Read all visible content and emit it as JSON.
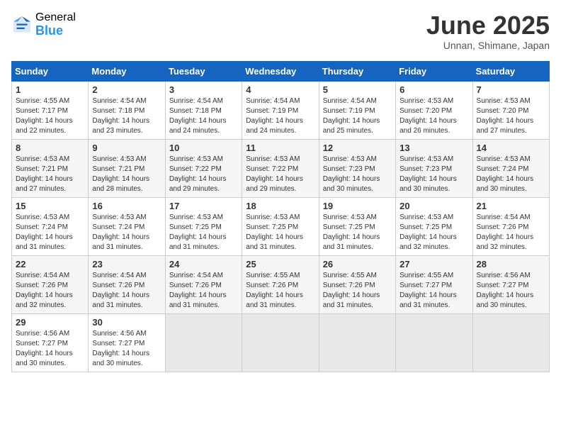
{
  "header": {
    "logo_general": "General",
    "logo_blue": "Blue",
    "title": "June 2025",
    "subtitle": "Unnan, Shimane, Japan"
  },
  "calendar": {
    "days_of_week": [
      "Sunday",
      "Monday",
      "Tuesday",
      "Wednesday",
      "Thursday",
      "Friday",
      "Saturday"
    ],
    "weeks": [
      [
        {
          "day": "1",
          "sunrise": "4:55 AM",
          "sunset": "7:17 PM",
          "daylight": "14 hours and 22 minutes."
        },
        {
          "day": "2",
          "sunrise": "4:54 AM",
          "sunset": "7:18 PM",
          "daylight": "14 hours and 23 minutes."
        },
        {
          "day": "3",
          "sunrise": "4:54 AM",
          "sunset": "7:18 PM",
          "daylight": "14 hours and 24 minutes."
        },
        {
          "day": "4",
          "sunrise": "4:54 AM",
          "sunset": "7:19 PM",
          "daylight": "14 hours and 24 minutes."
        },
        {
          "day": "5",
          "sunrise": "4:54 AM",
          "sunset": "7:19 PM",
          "daylight": "14 hours and 25 minutes."
        },
        {
          "day": "6",
          "sunrise": "4:53 AM",
          "sunset": "7:20 PM",
          "daylight": "14 hours and 26 minutes."
        },
        {
          "day": "7",
          "sunrise": "4:53 AM",
          "sunset": "7:20 PM",
          "daylight": "14 hours and 27 minutes."
        }
      ],
      [
        {
          "day": "8",
          "sunrise": "4:53 AM",
          "sunset": "7:21 PM",
          "daylight": "14 hours and 27 minutes."
        },
        {
          "day": "9",
          "sunrise": "4:53 AM",
          "sunset": "7:21 PM",
          "daylight": "14 hours and 28 minutes."
        },
        {
          "day": "10",
          "sunrise": "4:53 AM",
          "sunset": "7:22 PM",
          "daylight": "14 hours and 29 minutes."
        },
        {
          "day": "11",
          "sunrise": "4:53 AM",
          "sunset": "7:22 PM",
          "daylight": "14 hours and 29 minutes."
        },
        {
          "day": "12",
          "sunrise": "4:53 AM",
          "sunset": "7:23 PM",
          "daylight": "14 hours and 30 minutes."
        },
        {
          "day": "13",
          "sunrise": "4:53 AM",
          "sunset": "7:23 PM",
          "daylight": "14 hours and 30 minutes."
        },
        {
          "day": "14",
          "sunrise": "4:53 AM",
          "sunset": "7:24 PM",
          "daylight": "14 hours and 30 minutes."
        }
      ],
      [
        {
          "day": "15",
          "sunrise": "4:53 AM",
          "sunset": "7:24 PM",
          "daylight": "14 hours and 31 minutes."
        },
        {
          "day": "16",
          "sunrise": "4:53 AM",
          "sunset": "7:24 PM",
          "daylight": "14 hours and 31 minutes."
        },
        {
          "day": "17",
          "sunrise": "4:53 AM",
          "sunset": "7:25 PM",
          "daylight": "14 hours and 31 minutes."
        },
        {
          "day": "18",
          "sunrise": "4:53 AM",
          "sunset": "7:25 PM",
          "daylight": "14 hours and 31 minutes."
        },
        {
          "day": "19",
          "sunrise": "4:53 AM",
          "sunset": "7:25 PM",
          "daylight": "14 hours and 31 minutes."
        },
        {
          "day": "20",
          "sunrise": "4:53 AM",
          "sunset": "7:25 PM",
          "daylight": "14 hours and 32 minutes."
        },
        {
          "day": "21",
          "sunrise": "4:54 AM",
          "sunset": "7:26 PM",
          "daylight": "14 hours and 32 minutes."
        }
      ],
      [
        {
          "day": "22",
          "sunrise": "4:54 AM",
          "sunset": "7:26 PM",
          "daylight": "14 hours and 32 minutes."
        },
        {
          "day": "23",
          "sunrise": "4:54 AM",
          "sunset": "7:26 PM",
          "daylight": "14 hours and 31 minutes."
        },
        {
          "day": "24",
          "sunrise": "4:54 AM",
          "sunset": "7:26 PM",
          "daylight": "14 hours and 31 minutes."
        },
        {
          "day": "25",
          "sunrise": "4:55 AM",
          "sunset": "7:26 PM",
          "daylight": "14 hours and 31 minutes."
        },
        {
          "day": "26",
          "sunrise": "4:55 AM",
          "sunset": "7:26 PM",
          "daylight": "14 hours and 31 minutes."
        },
        {
          "day": "27",
          "sunrise": "4:55 AM",
          "sunset": "7:27 PM",
          "daylight": "14 hours and 31 minutes."
        },
        {
          "day": "28",
          "sunrise": "4:56 AM",
          "sunset": "7:27 PM",
          "daylight": "14 hours and 30 minutes."
        }
      ],
      [
        {
          "day": "29",
          "sunrise": "4:56 AM",
          "sunset": "7:27 PM",
          "daylight": "14 hours and 30 minutes."
        },
        {
          "day": "30",
          "sunrise": "4:56 AM",
          "sunset": "7:27 PM",
          "daylight": "14 hours and 30 minutes."
        },
        null,
        null,
        null,
        null,
        null
      ]
    ]
  }
}
